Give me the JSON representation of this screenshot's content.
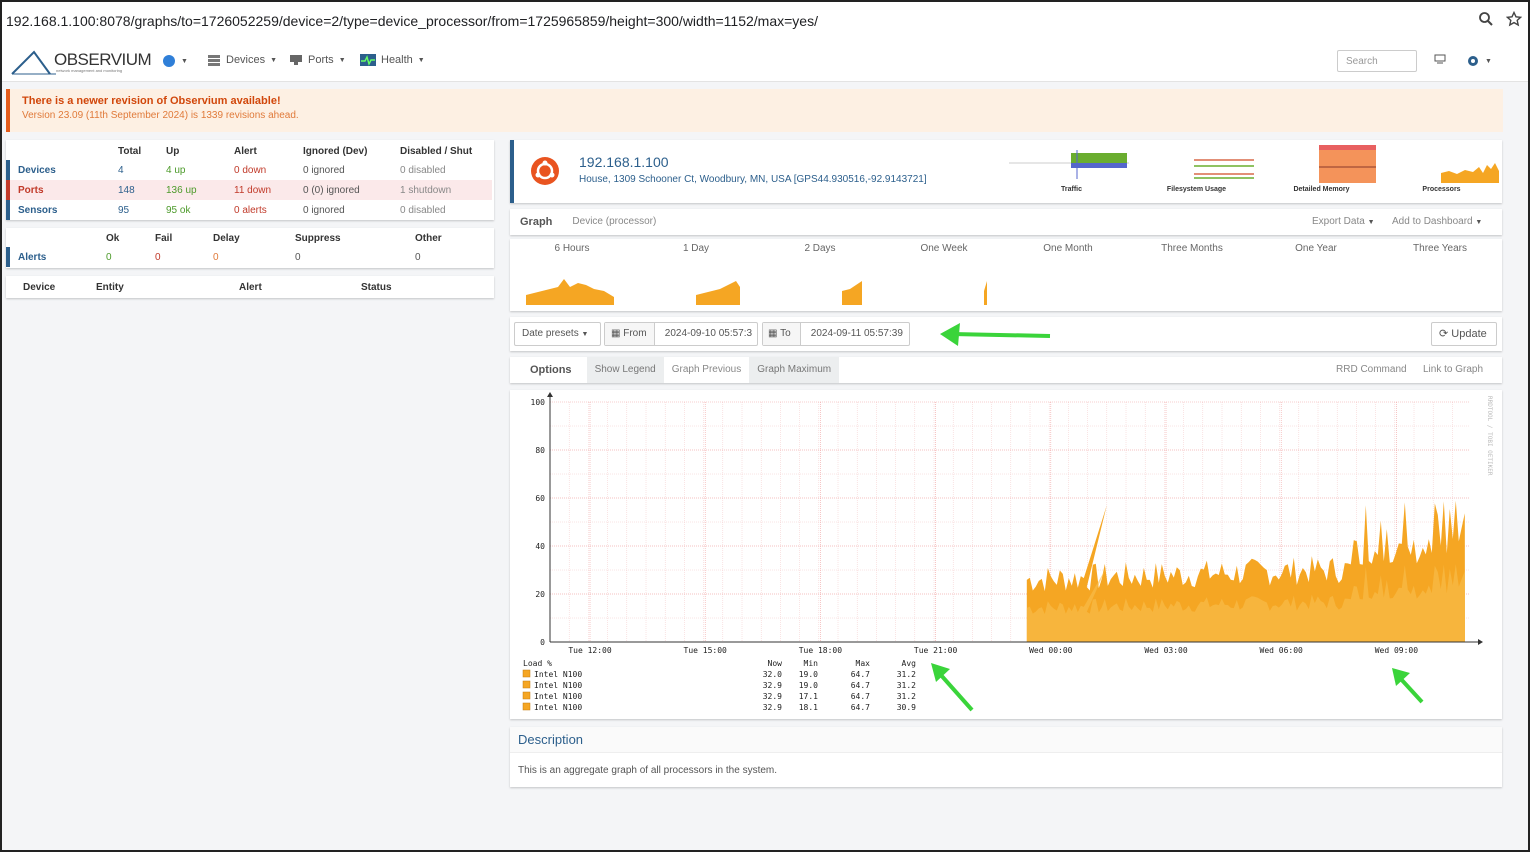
{
  "browser": {
    "url": "192.168.1.100:8078/graphs/to=1726052259/device=2/type=device_processor/from=1725965859/height=300/width=1152/max=yes/"
  },
  "navbar": {
    "logo": "OBSERVIUM",
    "logo_sub": "network management and monitoring",
    "devices": "Devices",
    "ports": "Ports",
    "health": "Health",
    "search_placeholder": "Search"
  },
  "alert": {
    "title": "There is a newer revision of Observium available!",
    "detail": "Version 23.09 (11th September 2024) is 1339 revisions ahead."
  },
  "summary": {
    "headers": [
      "",
      "Total",
      "Up",
      "Alert",
      "Ignored (Dev)",
      "Disabled / Shut"
    ],
    "rows": [
      {
        "label": "Devices",
        "total": "4",
        "up": "4 up",
        "alert": "0 down",
        "ignored": "0 ignored",
        "disabled": "0 disabled"
      },
      {
        "label": "Ports",
        "total": "148",
        "up": "136 up",
        "alert": "11 down",
        "ignored": "0 (0) ignored",
        "disabled": "1 shutdown"
      },
      {
        "label": "Sensors",
        "total": "95",
        "up": "95 ok",
        "alert": "0 alerts",
        "ignored": "0 ignored",
        "disabled": "0 disabled"
      }
    ]
  },
  "alerts_table": {
    "headers": [
      "",
      "Ok",
      "Fail",
      "Delay",
      "Suppress",
      "Other"
    ],
    "row": {
      "label": "Alerts",
      "ok": "0",
      "fail": "0",
      "delay": "0",
      "suppress": "0",
      "other": "0"
    }
  },
  "entity_table": {
    "headers": [
      "Device",
      "Entity",
      "Alert",
      "Status"
    ]
  },
  "device": {
    "name": "192.168.1.100",
    "location": "House, 1309 Schooner Ct, Woodbury, MN, USA [GPS44.930516,-92.9143721]",
    "mini_graphs": [
      "Traffic",
      "Filesystem Usage",
      "Detailed Memory",
      "Processors"
    ]
  },
  "graph_tabs": {
    "graph": "Graph",
    "subtitle": "Device (processor)",
    "export": "Export Data",
    "dashboard": "Add to Dashboard"
  },
  "periods": [
    "6 Hours",
    "1 Day",
    "2 Days",
    "One Week",
    "One Month",
    "Three Months",
    "One Year",
    "Three Years"
  ],
  "date_controls": {
    "presets": "Date presets",
    "from_label": "From",
    "from_value": "2024-09-10 05:57:3",
    "to_label": "To",
    "to_value": "2024-09-11 05:57:39",
    "update": "Update"
  },
  "options_bar": {
    "options": "Options",
    "legend": "Show Legend",
    "previous": "Graph Previous",
    "maximum": "Graph Maximum",
    "rrd": "RRD Command",
    "link": "Link to Graph"
  },
  "chart_data": {
    "type": "area",
    "ylim": [
      0,
      100
    ],
    "yticks": [
      0,
      20,
      40,
      60,
      80,
      100
    ],
    "xticks": [
      "Tue 12:00",
      "Tue 15:00",
      "Tue 18:00",
      "Tue 21:00",
      "Wed 00:00",
      "Wed 03:00",
      "Wed 06:00",
      "Wed 09:00"
    ],
    "watermark": "RRDTOOL / TOBI OETIKER",
    "grid": true,
    "series_color": "#f5a623",
    "legend_header": [
      "Load %",
      "Now",
      "Min",
      "Max",
      "Avg"
    ],
    "legend": [
      {
        "name": "Intel N100",
        "now": "32.0",
        "min": "19.0",
        "max": "64.7",
        "avg": "31.2"
      },
      {
        "name": "Intel N100",
        "now": "32.9",
        "min": "19.0",
        "max": "64.7",
        "avg": "31.2"
      },
      {
        "name": "Intel N100",
        "now": "32.9",
        "min": "17.1",
        "max": "64.7",
        "avg": "31.2"
      },
      {
        "name": "Intel N100",
        "now": "32.9",
        "min": "18.1",
        "max": "64.7",
        "avg": "30.9"
      }
    ]
  },
  "description": {
    "title": "Description",
    "text": "This is an aggregate graph of all processors in the system."
  }
}
